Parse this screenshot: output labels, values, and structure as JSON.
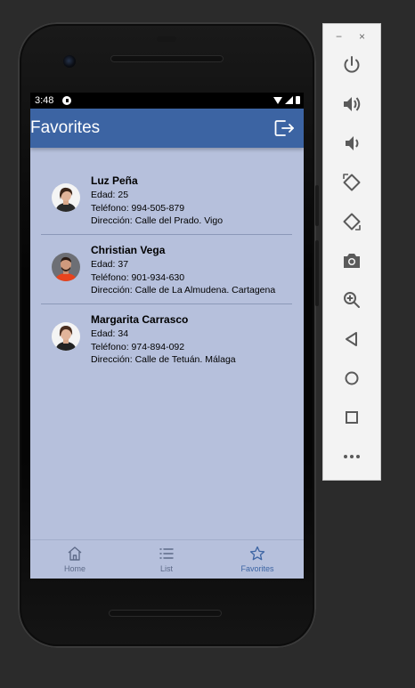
{
  "status_bar": {
    "time": "3:48"
  },
  "app_bar": {
    "title": "Favorites",
    "logout_icon": "logout-icon"
  },
  "favorites": [
    {
      "name": "Luz Peña",
      "edad": "Edad: 25",
      "telefono": "Teléfono: 994-505-879",
      "direccion": "Dirección: Calle del Prado. Vigo"
    },
    {
      "name": "Christian Vega",
      "edad": "Edad: 37",
      "telefono": "Teléfono: 901-934-630",
      "direccion": "Dirección: Calle de La Almudena. Cartagena"
    },
    {
      "name": "Margarita Carrasco",
      "edad": "Edad: 34",
      "telefono": "Teléfono: 974-894-092",
      "direccion": "Dirección: Calle de Tetuán. Málaga"
    }
  ],
  "bottom_nav": {
    "items": [
      {
        "label": "Home",
        "icon": "home-icon"
      },
      {
        "label": "List",
        "icon": "list-icon"
      },
      {
        "label": "Favorites",
        "icon": "star-icon"
      }
    ],
    "active": "Favorites"
  },
  "emulator_panel": {
    "minimize": "−",
    "close": "×",
    "buttons": [
      "power-icon",
      "volume-up-icon",
      "volume-down-icon",
      "rotate-left-icon",
      "rotate-right-icon",
      "camera-icon",
      "zoom-icon",
      "back-icon",
      "home-circle-icon",
      "overview-icon",
      "more-icon"
    ]
  },
  "colors": {
    "app_bar": "#3c64a3",
    "screen_bg": "#b6c0dc",
    "active_nav": "#3c64a3",
    "inactive_nav": "#5d6a88"
  }
}
